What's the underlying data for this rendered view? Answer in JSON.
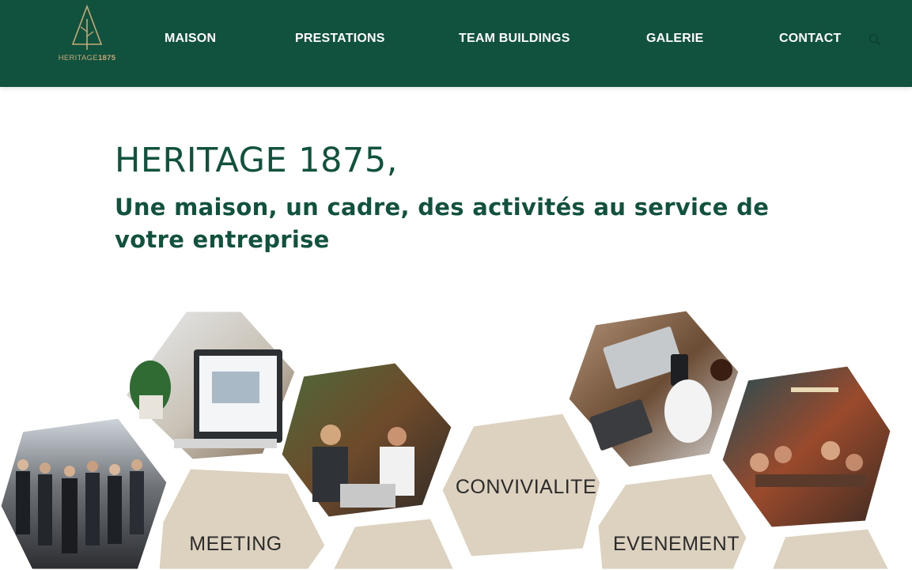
{
  "header": {
    "logo": {
      "word": "HERITAGE",
      "number": "1875"
    },
    "nav": [
      {
        "label": "MAISON"
      },
      {
        "label": "PRESTATIONS"
      },
      {
        "label": "TEAM BUILDINGS"
      },
      {
        "label": "GALERIE"
      },
      {
        "label": "CONTACT"
      }
    ],
    "search_icon": "search-icon"
  },
  "hero": {
    "title": "HERITAGE 1875,",
    "subtitle": "Une maison, un cadre, des activités au service de votre entreprise"
  },
  "collage": {
    "labels": {
      "meeting": "MEETING",
      "convivialite": "CONVIVIALITE",
      "evenement": "EVENEMENT"
    },
    "images": [
      {
        "name": "laptop-office-photo"
      },
      {
        "name": "business-team-photo"
      },
      {
        "name": "meeting-pair-photo"
      },
      {
        "name": "tablet-coffee-photo"
      },
      {
        "name": "restaurant-crowd-photo"
      }
    ]
  },
  "colors": {
    "brand_green": "#11523f",
    "gold": "#c7a877",
    "beige_hex": "#ddd2c0",
    "white": "#ffffff"
  }
}
